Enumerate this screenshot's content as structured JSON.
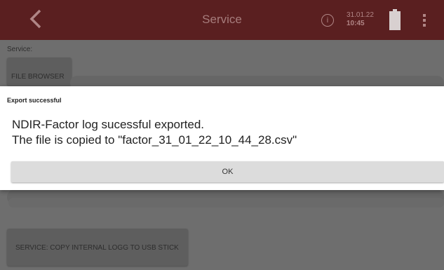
{
  "appbar": {
    "title": "Service",
    "info_icon": "info-icon",
    "info_glyph": "i",
    "date": "31.01.22",
    "time": "10:45",
    "battery_icon": "battery-icon",
    "menu_icon": "more-vert-icon",
    "back_icon": "chevron-left-icon"
  },
  "page": {
    "label": "Service:",
    "file_browser_label": "FILE BROWSER",
    "usb_button_label": "SERVICE: COPY INTERNAL LOGG TO USB STICK"
  },
  "dialog": {
    "title": "Export successful",
    "message_line1": "NDIR-Factor log sucessful exported.",
    "message_line2": "The file is copied to \"factor_31_01_22_10_44_28.csv\"",
    "ok_label": "OK"
  },
  "colors": {
    "appbar_bg": "#5a1f20",
    "overlay_bg": "#6e6e6e",
    "dialog_bg": "#ffffff",
    "button_bg": "#dcdcdc"
  }
}
